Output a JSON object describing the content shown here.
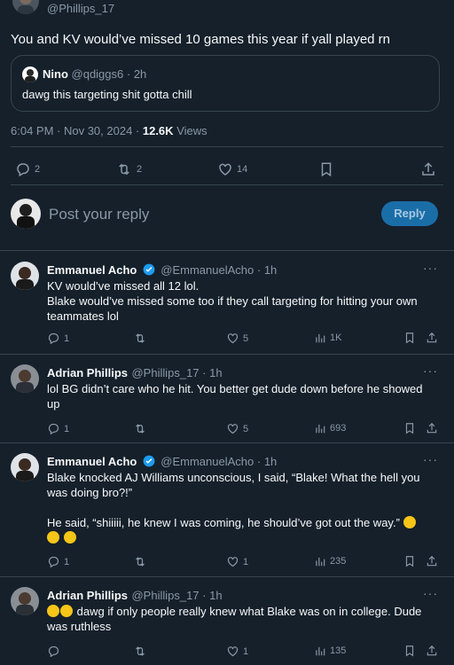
{
  "main_tweet": {
    "handle": "@Phillips_17",
    "text": "You and KV would’ve missed 10 games this year if yall played rn",
    "quoted": {
      "name": "Nino",
      "handle": "@qdiggs6",
      "time": "2h",
      "text": "dawg this targeting shit gotta chill"
    },
    "timestamp": "6:04 PM · Nov 30, 2024 · ",
    "views_count": "12.6K",
    "views_label": "Views",
    "actions": {
      "replies": "2",
      "reposts": "2",
      "likes": "14"
    }
  },
  "composer": {
    "placeholder": "Post your reply",
    "button": "Reply"
  },
  "replies": [
    {
      "name": "Emmanuel Acho",
      "verified": true,
      "handle": "@EmmanuelAcho",
      "time": "1h",
      "lines": [
        "KV would’ve missed all 12 lol.",
        "Blake would’ve missed some too if they call targeting for hitting your own teammates lol"
      ],
      "stats": {
        "replies": "1",
        "reposts": "",
        "likes": "5",
        "views": "1K"
      }
    },
    {
      "name": "Adrian Phillips",
      "verified": false,
      "handle": "@Phillips_17",
      "time": "1h",
      "lines": [
        "lol BG didn’t care who he hit. You better get dude down before he showed up"
      ],
      "stats": {
        "replies": "1",
        "reposts": "",
        "likes": "5",
        "views": "693"
      }
    },
    {
      "name": "Emmanuel Acho",
      "verified": true,
      "handle": "@EmmanuelAcho",
      "time": "1h",
      "lines": [
        "Blake knocked AJ Williams unconscious, I said, “Blake! What the hell you was doing bro?!”",
        "He said, “shiiiii, he knew I was coming, he should’ve got out the way.”"
      ],
      "stats": {
        "replies": "1",
        "reposts": "",
        "likes": "1",
        "views": "235"
      }
    },
    {
      "name": "Adrian Phillips",
      "verified": false,
      "handle": "@Phillips_17",
      "time": "1h",
      "lines": [
        "dawg if only people really knew what Blake was on in college. Dude was ruthless"
      ],
      "stats": {
        "replies": "",
        "reposts": "",
        "likes": "1",
        "views": "135"
      }
    }
  ],
  "sep": " · ",
  "more": "···",
  "colors": {
    "bg": "#15202b",
    "accent": "#1d9bf0",
    "muted": "#8b98a5",
    "border": "#38444d",
    "reply_button": "#1a6ea8"
  }
}
